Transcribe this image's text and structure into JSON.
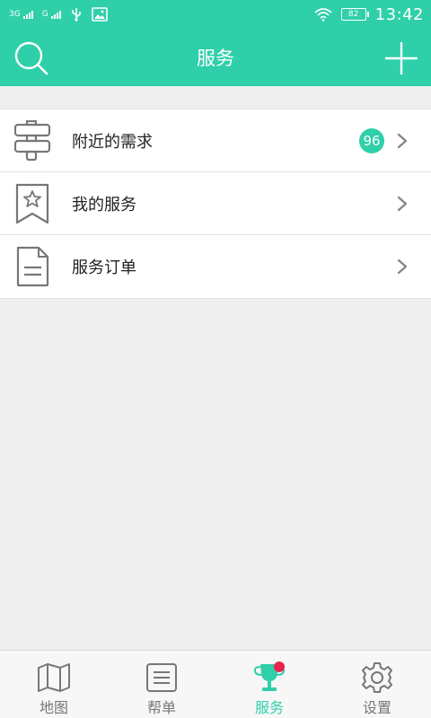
{
  "status_bar": {
    "signal1_label": "3G",
    "signal2_label": "G",
    "battery": "82",
    "time": "13:42",
    "icons": [
      "signal-icon",
      "signal-icon",
      "usb-icon",
      "image-icon",
      "wifi-icon",
      "battery-icon"
    ]
  },
  "header": {
    "title": "服务",
    "left_icon": "search-icon",
    "right_icon": "plus-icon"
  },
  "list": {
    "items": [
      {
        "label": "附近的需求",
        "icon": "signpost-icon",
        "badge": "96"
      },
      {
        "label": "我的服务",
        "icon": "bookmark-star-icon"
      },
      {
        "label": "服务订单",
        "icon": "document-icon"
      }
    ]
  },
  "bottom_nav": {
    "items": [
      {
        "label": "地图",
        "icon": "map-icon",
        "active": false
      },
      {
        "label": "帮单",
        "icon": "list-icon",
        "active": false
      },
      {
        "label": "服务",
        "icon": "trophy-icon",
        "active": true,
        "dot": true
      },
      {
        "label": "设置",
        "icon": "gear-icon",
        "active": false
      }
    ]
  },
  "colors": {
    "accent": "#2fcfa9",
    "notification_dot": "#e8254d"
  }
}
